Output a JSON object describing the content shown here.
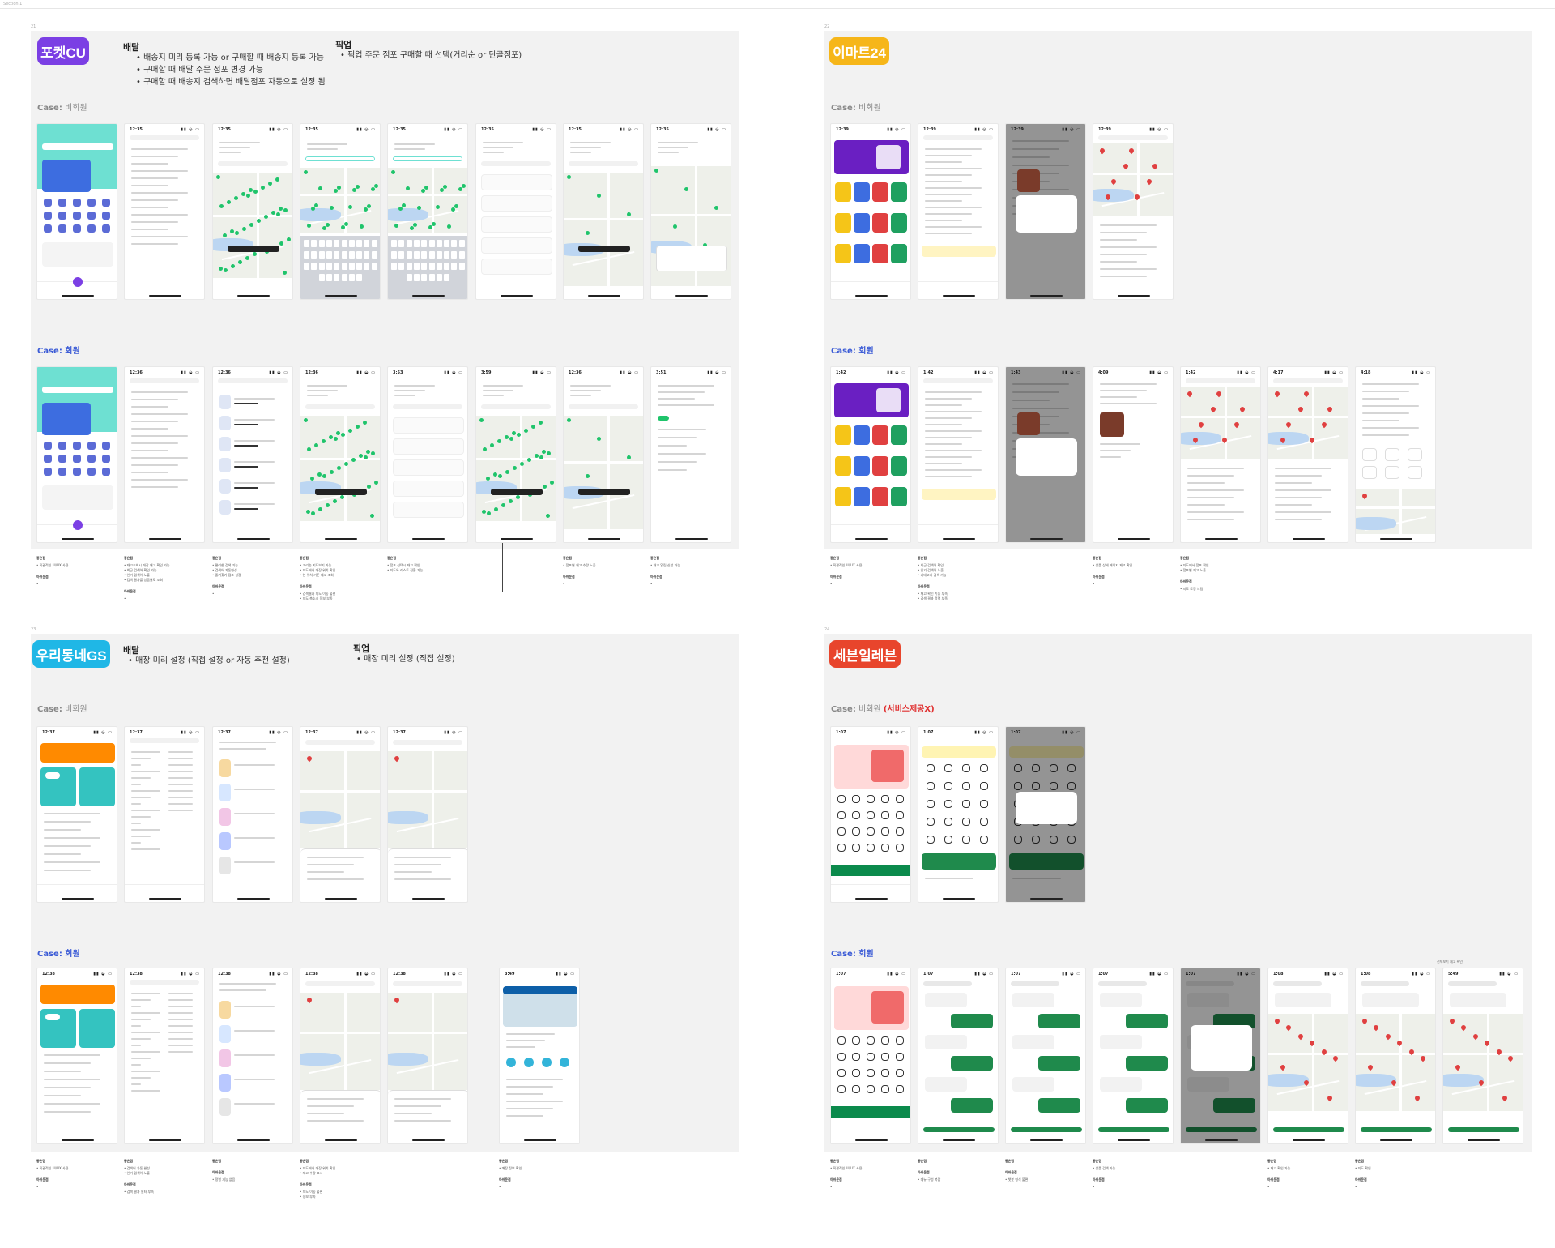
{
  "frame_label": "Section 1",
  "panels": {
    "cu": {
      "num": "21",
      "brand": "포켓CU",
      "brand_color": "#7b3fe4",
      "delivery_title": "배달",
      "delivery_items": [
        "배송지 미리 등록 가능 or 구매할 때 배송지 등록 가능",
        "구매할 때 배달 주문 점포 변경 가능",
        "구매할 때 배송지 검색하면 배달점포 자동으로 설정 됨"
      ],
      "pickup_title": "픽업",
      "pickup_items": [
        "픽업 주문 점포 구매할 때 선택(거리순 or 단골점포)"
      ],
      "case_guest_prefix": "Case:",
      "case_guest": "비회원",
      "case_member": "Case: 회원",
      "notes": [
        {
          "h": "좋은점",
          "lines": [
            "• 직관적인 UI/UX 사용"
          ],
          "h2": "아쉬운점",
          "lines2": [
            "•"
          ]
        },
        {
          "h": "좋은점",
          "lines": [
            "• 재고조회시 매장 재고 확인 가능",
            "• 최근 검색어 확인 가능",
            "• 인기 검색어 노출",
            "• 검색 결과를 상품별로 조회"
          ],
          "h2": "아쉬운점",
          "lines2": [
            "•"
          ]
        },
        {
          "h": "좋은점",
          "lines": [
            "• 편리한 검색 기능",
            "• 검색어 자동완성",
            "• 즐겨찾기 점포 설정"
          ],
          "h2": "아쉬운점",
          "lines2": [
            "•"
          ]
        },
        {
          "h": "좋은점",
          "lines": [
            "• 거리순 지도보기 가능",
            "• 지도에서 매장 위치 확인",
            "• 현 위치 기준 재고 조회"
          ],
          "h2": "아쉬운점",
          "lines2": [
            "• 검색결과 지도 이동 불편",
            "• 지도 축소시 정보 부족"
          ]
        },
        {
          "h": "좋은점",
          "lines": [
            "• 점포 선택시 재고 확인",
            "• 지도와 리스트 전환 가능"
          ],
          "h2": "",
          "lines2": []
        },
        {
          "h": "좋은점",
          "lines": [
            "• 점포별 재고 수량 노출"
          ],
          "h2": "아쉬운점",
          "lines2": [
            "•"
          ]
        },
        {
          "h": "좋은점",
          "lines": [
            "• 재고 알림 신청 가능"
          ],
          "h2": "아쉬운점",
          "lines2": [
            "•"
          ]
        }
      ]
    },
    "emart": {
      "num": "22",
      "brand": "이마트24",
      "brand_color": "#f6b619",
      "case_guest_prefix": "Case:",
      "case_guest": "비회원",
      "case_member": "Case: 회원",
      "notes": [
        {
          "h": "좋은점",
          "lines": [
            "• 직관적인 UI/UX 사용"
          ],
          "h2": "아쉬운점",
          "lines2": [
            "•"
          ]
        },
        {
          "h": "좋은점",
          "lines": [
            "• 최근 검색어 확인",
            "• 인기 검색어 노출",
            "• 카테고리 검색 가능"
          ],
          "h2": "아쉬운점",
          "lines2": [
            "• 재고 확인 기능 부족",
            "• 검색 결과 정렬 부족"
          ]
        },
        {
          "h": "좋은점",
          "lines": [
            "• 상품 상세 페이지 재고 확인"
          ],
          "h2": "아쉬운점",
          "lines2": [
            "•"
          ]
        },
        {
          "h": "좋은점",
          "lines": [
            "• 지도에서 점포 확인",
            "• 점포별 재고 노출"
          ],
          "h2": "아쉬운점",
          "lines2": [
            "• 지도 로딩 느림"
          ]
        }
      ]
    },
    "gs": {
      "num": "23",
      "brand": "우리동네GS",
      "brand_color": "#1fb7e6",
      "delivery_title": "배달",
      "delivery_items": [
        "매장 미리 설정 (직접 설정 or 자동 추천 설정)"
      ],
      "pickup_title": "픽업",
      "pickup_items": [
        "매장 미리 설정 (직접 설정)"
      ],
      "case_guest_prefix": "Case:",
      "case_guest": "비회원",
      "case_member": "Case: 회원",
      "notes": [
        {
          "h": "좋은점",
          "lines": [
            "• 직관적인 UI/UX 사용"
          ],
          "h2": "아쉬운점",
          "lines2": [
            "•"
          ]
        },
        {
          "h": "좋은점",
          "lines": [
            "• 검색어 자동 완성",
            "• 인기 검색어 노출"
          ],
          "h2": "아쉬운점",
          "lines2": [
            "• 검색 결과 필터 부족"
          ]
        },
        {
          "h": "좋은점",
          "lines": [],
          "h2": "아쉬운점",
          "lines2": [
            "• 정렬 기능 없음"
          ]
        },
        {
          "h": "좋은점",
          "lines": [
            "• 지도에서 매장 위치 확인",
            "• 재고 수량 표시"
          ],
          "h2": "아쉬운점",
          "lines2": [
            "• 지도 이동 불편",
            "• 정보 부족"
          ]
        },
        {
          "h": "좋은점",
          "lines": [
            "• 매장 정보 확인"
          ],
          "h2": "아쉬운점",
          "lines2": [
            "•"
          ]
        }
      ]
    },
    "seven": {
      "num": "24",
      "brand": "세븐일레븐",
      "brand_color": "#e8452c",
      "case_guest_prefix": "Case:",
      "case_guest": "비회원",
      "case_guest_extra": "(서비스제공X)",
      "case_member": "Case: 회원",
      "extra_label": "전체보기 재고 확인",
      "notes": [
        {
          "h": "좋은점",
          "lines": [
            "• 직관적인 UI/UX 사용"
          ],
          "h2": "아쉬운점",
          "lines2": [
            "•"
          ]
        },
        {
          "h": "좋은점",
          "lines": [],
          "h2": "아쉬운점",
          "lines2": [
            "• 메뉴 구성 복잡"
          ]
        },
        {
          "h": "좋은점",
          "lines": [],
          "h2": "아쉬운점",
          "lines2": [
            "• 챗봇 형식 불편"
          ]
        },
        {
          "h": "좋은점",
          "lines": [
            "• 상품 검색 가능"
          ],
          "h2": "아쉬운점",
          "lines2": [
            "•"
          ]
        },
        {
          "h": "좋은점",
          "lines": [
            "• 재고 확인 가능"
          ],
          "h2": "아쉬운점",
          "lines2": [
            "•"
          ]
        },
        {
          "h": "좋은점",
          "lines": [
            "• 지도 확인"
          ],
          "h2": "아쉬운점",
          "lines2": [
            "•"
          ]
        }
      ]
    }
  },
  "phone_times": {
    "cu_guest": [
      "12:35",
      "12:35",
      "12:35",
      "12:35",
      "12:35",
      "12:35",
      "12:35",
      "12:35"
    ],
    "cu_member": [
      "12:36",
      "12:36",
      "12:36",
      "12:36",
      "3:53",
      "3:59",
      "12:36",
      "3:51"
    ],
    "emart_guest": [
      "12:39",
      "12:39",
      "12:39",
      "12:39"
    ],
    "emart_member": [
      "1:42",
      "1:42",
      "1:43",
      "4:09",
      "1:42",
      "4:17",
      "4:18"
    ],
    "gs_guest": [
      "12:37",
      "12:37",
      "12:37",
      "12:37",
      "12:37"
    ],
    "gs_member": [
      "12:38",
      "12:38",
      "12:38",
      "12:38",
      "12:38",
      "3:49"
    ],
    "seven_guest": [
      "1:07",
      "1:07",
      "1:07"
    ],
    "seven_member": [
      "1:07",
      "1:07",
      "1:07",
      "1:07",
      "1:07",
      "1:08",
      "1:08",
      "5:49"
    ]
  }
}
